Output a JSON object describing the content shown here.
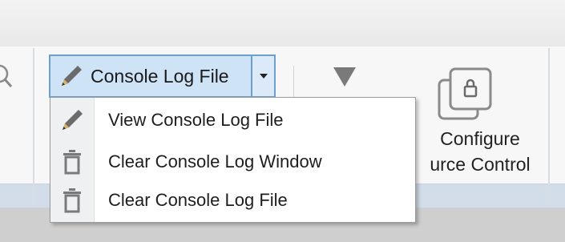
{
  "toolbar": {
    "console_log_button": {
      "label": "Console Log File",
      "icon": "pencil-icon",
      "dropdown_icon": "caret-down-icon"
    },
    "filter_button": {
      "icon": "filter-icon"
    },
    "configure_source_control": {
      "line1": "Configure",
      "line2": "urce Control",
      "icon": "locked-documents-icon"
    }
  },
  "dropdown_menu": {
    "items": [
      {
        "label": "View Console Log File",
        "icon": "pencil-icon"
      },
      {
        "label": "Clear Console Log Window",
        "icon": "trash-icon"
      },
      {
        "label": "Clear Console Log File",
        "icon": "trash-icon"
      }
    ]
  },
  "colors": {
    "button_highlight": "#cfe3f7",
    "button_border": "#6d9ed0",
    "ribbon_footer": "#d2dde9",
    "menu_background": "#ffffff"
  }
}
